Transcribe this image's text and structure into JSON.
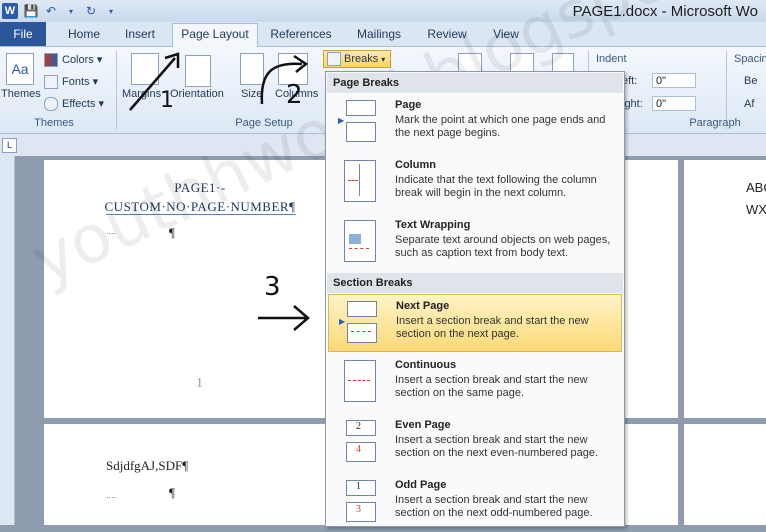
{
  "window": {
    "title": "PAGE1.docx - Microsoft Wo"
  },
  "tabs": [
    {
      "label": "File"
    },
    {
      "label": "Home"
    },
    {
      "label": "Insert"
    },
    {
      "label": "Page Layout"
    },
    {
      "label": "References"
    },
    {
      "label": "Mailings"
    },
    {
      "label": "Review"
    },
    {
      "label": "View"
    }
  ],
  "ribbon": {
    "themes": {
      "themes_label": "Themes",
      "colors_label": "Colors",
      "fonts_label": "Fonts",
      "effects_label": "Effects",
      "group_label": "Themes"
    },
    "page_setup": {
      "margins_label": "Margins",
      "orientation_label": "Orientation",
      "size_label": "Size",
      "columns_label": "Columns",
      "breaks_label": "Breaks",
      "group_label": "Page Setup"
    },
    "paragraph": {
      "indent_label": "Indent",
      "left_label": "eft:",
      "left_value": "0\"",
      "right_label": "ight:",
      "right_value": "0\"",
      "spacing_label": "Spacin",
      "before_label": "Be",
      "after_label": "Af",
      "group_label": "Paragraph"
    }
  },
  "document": {
    "page1_heading": "PAGE1·-CUSTOM·NO·PAGE·NUMBER¶",
    "page1_pilcrow": "¶",
    "page1_number": "1",
    "page2_text": "SdjdfgAJ,SDF¶",
    "page2_pilcrow": "¶",
    "right_page_line1": "ABC",
    "right_page_line2": "WX"
  },
  "breaks_menu": {
    "page_breaks_header": "Page Breaks",
    "section_breaks_header": "Section Breaks",
    "items": [
      {
        "title": "Page",
        "desc": "Mark the point at which one page ends and the next page begins."
      },
      {
        "title": "Column",
        "desc": "Indicate that the text following the column break will begin in the next column."
      },
      {
        "title": "Text Wrapping",
        "desc": "Separate text around objects on web pages, such as caption text from body text."
      },
      {
        "title": "Next Page",
        "desc": "Insert a section break and start the new section on the next page."
      },
      {
        "title": "Continuous",
        "desc": "Insert a section break and start the new section on the same page."
      },
      {
        "title": "Even Page",
        "desc": "Insert a section break and start the new section on the next even-numbered page."
      },
      {
        "title": "Odd Page",
        "desc": "Insert a section break and start the new section on the next odd-numbered page."
      }
    ]
  },
  "annotations": {
    "step1": "1",
    "step2": "2",
    "step3": "3"
  },
  "watermark": "youthhworld.blogspot.com"
}
